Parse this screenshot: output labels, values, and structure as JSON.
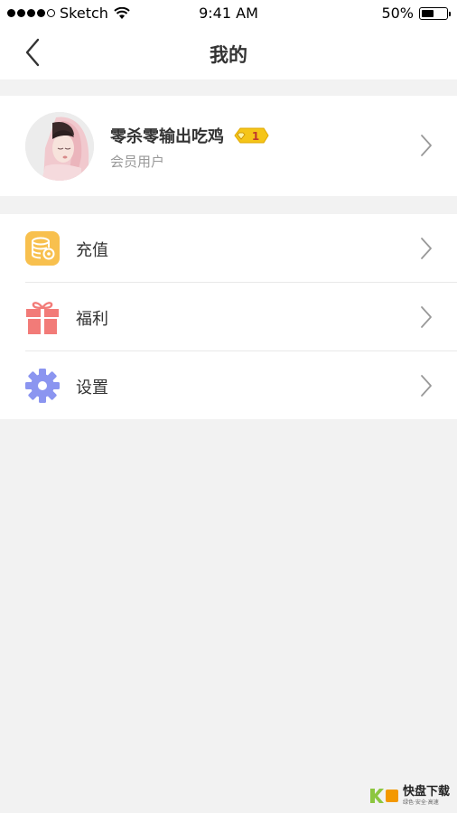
{
  "status_bar": {
    "carrier": "Sketch",
    "time": "9:41 AM",
    "battery": "50%",
    "battery_level": 0.5
  },
  "nav": {
    "title": "我的",
    "back_icon": "chevron-left-icon"
  },
  "profile": {
    "username": "零杀零输出吃鸡",
    "vip_level": "1",
    "role": "会员用户"
  },
  "menu": {
    "items": [
      {
        "label": "充值",
        "icon": "coin-database-icon",
        "color": "#f8c04e"
      },
      {
        "label": "福利",
        "icon": "gift-icon",
        "color": "#f27b78"
      },
      {
        "label": "设置",
        "icon": "gear-icon",
        "color": "#8b95f0"
      }
    ]
  },
  "watermark": {
    "brand": "快盘下载",
    "tagline": "绿色·安全·高速"
  },
  "colors": {
    "background": "#f2f2f2",
    "card": "#ffffff",
    "text_primary": "#333333",
    "text_secondary": "#999999",
    "vip_gold": "#f5c518"
  }
}
